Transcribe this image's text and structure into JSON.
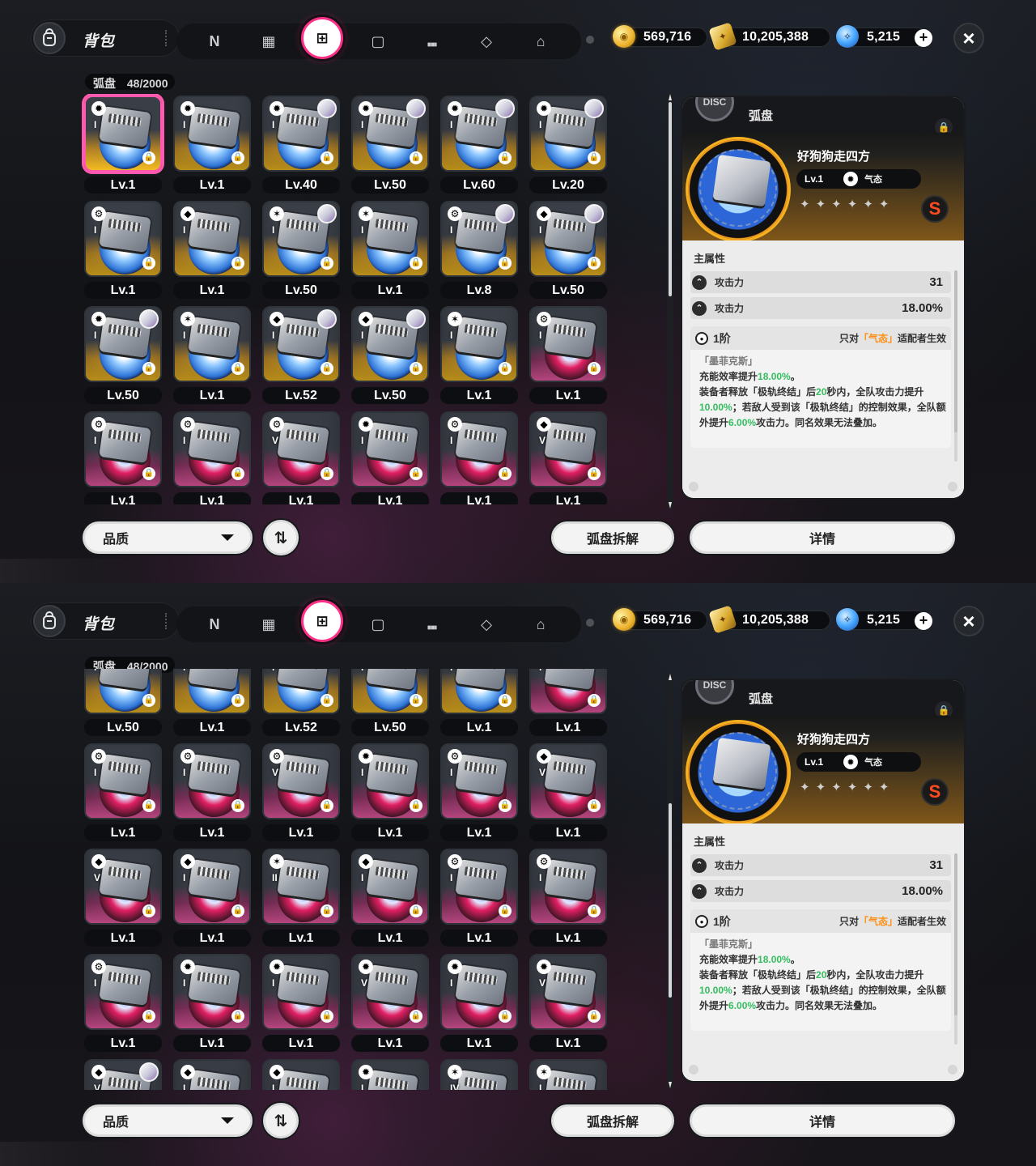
{
  "screens": [
    {
      "top_bar": {
        "bag_title": "背包",
        "tabs": [
          {
            "glyph": "N"
          },
          {
            "glyph": "▦"
          },
          {
            "glyph": "⊞"
          },
          {
            "glyph": "▢"
          },
          {
            "glyph": "⑉"
          },
          {
            "glyph": "◇"
          },
          {
            "glyph": "⌂"
          }
        ],
        "currencies": [
          {
            "icon": "gold-coin-icon",
            "value": "569,716"
          },
          {
            "icon": "ticket-icon",
            "value": "10,205,388"
          },
          {
            "icon": "polychrome-gem-icon",
            "value": "5,215"
          }
        ],
        "close_label": "×"
      },
      "category": {
        "label": "弧盘",
        "count": "48/2000"
      },
      "cards": [
        {
          "level": "Lv.1",
          "variant": "gold",
          "selected": true,
          "badge": "✹",
          "roman": "I",
          "has_avatar": false
        },
        {
          "level": "Lv.1",
          "variant": "gold",
          "selected": false,
          "badge": "✹",
          "roman": "I",
          "has_avatar": false
        },
        {
          "level": "Lv.40",
          "variant": "gold",
          "selected": false,
          "badge": "✹",
          "roman": "I",
          "has_avatar": true
        },
        {
          "level": "Lv.50",
          "variant": "gold",
          "selected": false,
          "badge": "✹",
          "roman": "I",
          "has_avatar": true
        },
        {
          "level": "Lv.60",
          "variant": "gold",
          "selected": false,
          "badge": "✹",
          "roman": "I",
          "has_avatar": true
        },
        {
          "level": "Lv.20",
          "variant": "gold",
          "selected": false,
          "badge": "✹",
          "roman": "I",
          "has_avatar": true
        },
        {
          "level": "Lv.1",
          "variant": "gold",
          "selected": false,
          "badge": "⚙",
          "roman": "I",
          "has_avatar": false
        },
        {
          "level": "Lv.1",
          "variant": "gold",
          "selected": false,
          "badge": "◆",
          "roman": "I",
          "has_avatar": false
        },
        {
          "level": "Lv.50",
          "variant": "gold",
          "selected": false,
          "badge": "✶",
          "roman": "I",
          "has_avatar": true
        },
        {
          "level": "Lv.1",
          "variant": "gold",
          "selected": false,
          "badge": "✶",
          "roman": "I",
          "has_avatar": false
        },
        {
          "level": "Lv.8",
          "variant": "gold",
          "selected": false,
          "badge": "⚙",
          "roman": "I",
          "has_avatar": true
        },
        {
          "level": "Lv.50",
          "variant": "gold",
          "selected": false,
          "badge": "◆",
          "roman": "I",
          "has_avatar": true
        },
        {
          "level": "Lv.50",
          "variant": "gold",
          "selected": false,
          "badge": "✹",
          "roman": "I",
          "has_avatar": true
        },
        {
          "level": "Lv.1",
          "variant": "gold",
          "selected": false,
          "badge": "✶",
          "roman": "I",
          "has_avatar": false
        },
        {
          "level": "Lv.52",
          "variant": "gold",
          "selected": false,
          "badge": "◆",
          "roman": "I",
          "has_avatar": true
        },
        {
          "level": "Lv.50",
          "variant": "gold",
          "selected": false,
          "badge": "◆",
          "roman": "I",
          "has_avatar": true
        },
        {
          "level": "Lv.1",
          "variant": "gold",
          "selected": false,
          "badge": "✶",
          "roman": "I",
          "has_avatar": false
        },
        {
          "level": "Lv.1",
          "variant": "pink",
          "selected": false,
          "badge": "⚙",
          "roman": "I",
          "has_avatar": false
        },
        {
          "level": "Lv.1",
          "variant": "pink",
          "selected": false,
          "badge": "⚙",
          "roman": "I",
          "has_avatar": false
        },
        {
          "level": "Lv.1",
          "variant": "pink",
          "selected": false,
          "badge": "⚙",
          "roman": "I",
          "has_avatar": false
        },
        {
          "level": "Lv.1",
          "variant": "pink",
          "selected": false,
          "badge": "⚙",
          "roman": "V",
          "has_avatar": false
        },
        {
          "level": "Lv.1",
          "variant": "pink",
          "selected": false,
          "badge": "✹",
          "roman": "I",
          "has_avatar": false
        },
        {
          "level": "Lv.1",
          "variant": "pink",
          "selected": false,
          "badge": "⚙",
          "roman": "I",
          "has_avatar": false
        },
        {
          "level": "Lv.1",
          "variant": "pink",
          "selected": false,
          "badge": "◆",
          "roman": "V",
          "has_avatar": false
        }
      ],
      "detail": {
        "panel_title": "弧盘",
        "disc_name": "好狗狗走四方",
        "level": "Lv.1",
        "attribute": "气态",
        "rank": "S",
        "stars": [
          "✦",
          "✦",
          "✦",
          "✦",
          "✦",
          "✦"
        ],
        "main_stats_title": "主属性",
        "stats": [
          {
            "name": "攻击力",
            "value": "31"
          },
          {
            "name": "攻击力",
            "value": "18.00%"
          }
        ],
        "effect": {
          "grade": "1阶",
          "condition_prefix": "只对",
          "condition_highlight": "「气态」",
          "condition_suffix": "适配者生效",
          "character": "「墨菲克斯」",
          "line1_prefix": "充能效率提升",
          "line1_value": "18.00%",
          "line1_suffix": "。",
          "line2_prefix": "装备者释放「极轨终结」后",
          "line2_value1": "20",
          "line2_mid": "秒内，全队攻击力提升",
          "line2_value2": "10.00%",
          "line2_mid2": "；若敌人受到该「极轨终结」的控制效果，全队额外提升",
          "line2_value3": "6.00%",
          "line2_suffix": "攻击力。同名效果无法叠加。"
        }
      },
      "buttons": {
        "quality": "品质",
        "sort": "⇅",
        "dismantle": "弧盘拆解",
        "details": "详情"
      }
    },
    {
      "top_bar": {
        "bag_title": "背包",
        "tabs": [
          {
            "glyph": "N"
          },
          {
            "glyph": "▦"
          },
          {
            "glyph": "⊞"
          },
          {
            "glyph": "▢"
          },
          {
            "glyph": "⑉"
          },
          {
            "glyph": "◇"
          },
          {
            "glyph": "⌂"
          }
        ],
        "currencies": [
          {
            "icon": "gold-coin-icon",
            "value": "569,716"
          },
          {
            "icon": "ticket-icon",
            "value": "10,205,388"
          },
          {
            "icon": "polychrome-gem-icon",
            "value": "5,215"
          }
        ],
        "close_label": "×"
      },
      "category": {
        "label": "弧盘",
        "count": "48/2000"
      },
      "cards": [
        {
          "level": "Lv.50",
          "variant": "gold",
          "selected": false,
          "badge": "✹",
          "roman": "I",
          "has_avatar": false
        },
        {
          "level": "Lv.1",
          "variant": "gold",
          "selected": false,
          "badge": "✶",
          "roman": "I",
          "has_avatar": false
        },
        {
          "level": "Lv.52",
          "variant": "gold",
          "selected": false,
          "badge": "◆",
          "roman": "I",
          "has_avatar": false
        },
        {
          "level": "Lv.50",
          "variant": "gold",
          "selected": false,
          "badge": "◆",
          "roman": "I",
          "has_avatar": false
        },
        {
          "level": "Lv.1",
          "variant": "gold",
          "selected": false,
          "badge": "✶",
          "roman": "I",
          "has_avatar": false
        },
        {
          "level": "Lv.1",
          "variant": "pink",
          "selected": false,
          "badge": "⚙",
          "roman": "I",
          "has_avatar": false
        },
        {
          "level": "Lv.1",
          "variant": "pink",
          "selected": false,
          "badge": "⚙",
          "roman": "I",
          "has_avatar": false
        },
        {
          "level": "Lv.1",
          "variant": "pink",
          "selected": false,
          "badge": "⚙",
          "roman": "I",
          "has_avatar": false
        },
        {
          "level": "Lv.1",
          "variant": "pink",
          "selected": false,
          "badge": "⚙",
          "roman": "V",
          "has_avatar": false
        },
        {
          "level": "Lv.1",
          "variant": "pink",
          "selected": false,
          "badge": "✹",
          "roman": "I",
          "has_avatar": false
        },
        {
          "level": "Lv.1",
          "variant": "pink",
          "selected": false,
          "badge": "⚙",
          "roman": "I",
          "has_avatar": false
        },
        {
          "level": "Lv.1",
          "variant": "pink",
          "selected": false,
          "badge": "◆",
          "roman": "V",
          "has_avatar": false
        },
        {
          "level": "Lv.1",
          "variant": "pink",
          "selected": false,
          "badge": "◆",
          "roman": "V",
          "has_avatar": false
        },
        {
          "level": "Lv.1",
          "variant": "pink",
          "selected": false,
          "badge": "◆",
          "roman": "I",
          "has_avatar": false
        },
        {
          "level": "Lv.1",
          "variant": "pink",
          "selected": false,
          "badge": "✶",
          "roman": "II",
          "has_avatar": false
        },
        {
          "level": "Lv.1",
          "variant": "pink",
          "selected": false,
          "badge": "◆",
          "roman": "I",
          "has_avatar": false
        },
        {
          "level": "Lv.1",
          "variant": "pink",
          "selected": false,
          "badge": "⚙",
          "roman": "I",
          "has_avatar": false
        },
        {
          "level": "Lv.1",
          "variant": "pink",
          "selected": false,
          "badge": "⚙",
          "roman": "I",
          "has_avatar": false
        },
        {
          "level": "Lv.1",
          "variant": "pink",
          "selected": false,
          "badge": "⚙",
          "roman": "I",
          "has_avatar": false
        },
        {
          "level": "Lv.1",
          "variant": "pink",
          "selected": false,
          "badge": "✹",
          "roman": "I",
          "has_avatar": false
        },
        {
          "level": "Lv.1",
          "variant": "pink",
          "selected": false,
          "badge": "✹",
          "roman": "I",
          "has_avatar": false
        },
        {
          "level": "Lv.1",
          "variant": "pink",
          "selected": false,
          "badge": "✹",
          "roman": "V",
          "has_avatar": false
        },
        {
          "level": "Lv.1",
          "variant": "pink",
          "selected": false,
          "badge": "✹",
          "roman": "I",
          "has_avatar": false
        },
        {
          "level": "Lv.1",
          "variant": "pink",
          "selected": false,
          "badge": "✹",
          "roman": "V",
          "has_avatar": false
        },
        {
          "level": "",
          "variant": "pink",
          "selected": false,
          "badge": "◆",
          "roman": "V",
          "has_avatar": true
        },
        {
          "level": "",
          "variant": "pink",
          "selected": false,
          "badge": "◆",
          "roman": "I",
          "has_avatar": false
        },
        {
          "level": "",
          "variant": "pink",
          "selected": false,
          "badge": "◆",
          "roman": "I",
          "has_avatar": false
        },
        {
          "level": "",
          "variant": "pink",
          "selected": false,
          "badge": "✹",
          "roman": "I",
          "has_avatar": false
        },
        {
          "level": "",
          "variant": "pink",
          "selected": false,
          "badge": "✶",
          "roman": "IV",
          "has_avatar": false
        },
        {
          "level": "",
          "variant": "pink",
          "selected": false,
          "badge": "✶",
          "roman": "I",
          "has_avatar": false
        }
      ],
      "detail": {
        "panel_title": "弧盘",
        "disc_name": "好狗狗走四方",
        "level": "Lv.1",
        "attribute": "气态",
        "rank": "S",
        "stars": [
          "✦",
          "✦",
          "✦",
          "✦",
          "✦",
          "✦"
        ],
        "main_stats_title": "主属性",
        "stats": [
          {
            "name": "攻击力",
            "value": "31"
          },
          {
            "name": "攻击力",
            "value": "18.00%"
          }
        ],
        "effect": {
          "grade": "1阶",
          "condition_prefix": "只对",
          "condition_highlight": "「气态」",
          "condition_suffix": "适配者生效",
          "character": "「墨菲克斯」",
          "line1_prefix": "充能效率提升",
          "line1_value": "18.00%",
          "line1_suffix": "。",
          "line2_prefix": "装备者释放「极轨终结」后",
          "line2_value1": "20",
          "line2_mid": "秒内，全队攻击力提升",
          "line2_value2": "10.00%",
          "line2_mid2": "；若敌人受到该「极轨终结」的控制效果，全队额外提升",
          "line2_value3": "6.00%",
          "line2_suffix": "攻击力。同名效果无法叠加。"
        }
      },
      "buttons": {
        "quality": "品质",
        "sort": "⇅",
        "dismantle": "弧盘拆解",
        "details": "详情"
      }
    }
  ]
}
